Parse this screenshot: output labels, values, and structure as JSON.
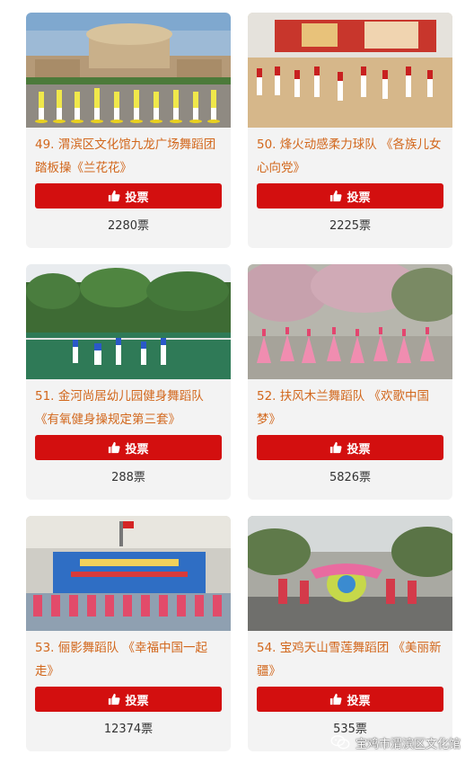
{
  "cards": [
    {
      "title": "49. 渭滨区文化馆九龙广场舞蹈团踏板操《兰花花》",
      "vote_label": "投票",
      "count": "2280票"
    },
    {
      "title": "50. 烽火动感柔力球队 《各族儿女心向党》",
      "vote_label": "投票",
      "count": "2225票"
    },
    {
      "title": "51. 金河尚居幼儿园健身舞蹈队 《有氧健身操规定第三套》",
      "vote_label": "投票",
      "count": "288票"
    },
    {
      "title": "52. 扶风木兰舞蹈队 《欢歌中国梦》",
      "vote_label": "投票",
      "count": "5826票"
    },
    {
      "title": "53. 俪影舞蹈队 《幸福中国一起走》",
      "vote_label": "投票",
      "count": "12374票"
    },
    {
      "title": "54. 宝鸡天山雪莲舞蹈团 《美丽新疆》",
      "vote_label": "投票",
      "count": "535票"
    }
  ],
  "watermark": {
    "text": "宝鸡市渭滨区文化馆",
    "icon": "wechat-icon"
  },
  "colors": {
    "title": "#d2671c",
    "button": "#d30f0f",
    "card_bg": "#f3f3f3"
  }
}
